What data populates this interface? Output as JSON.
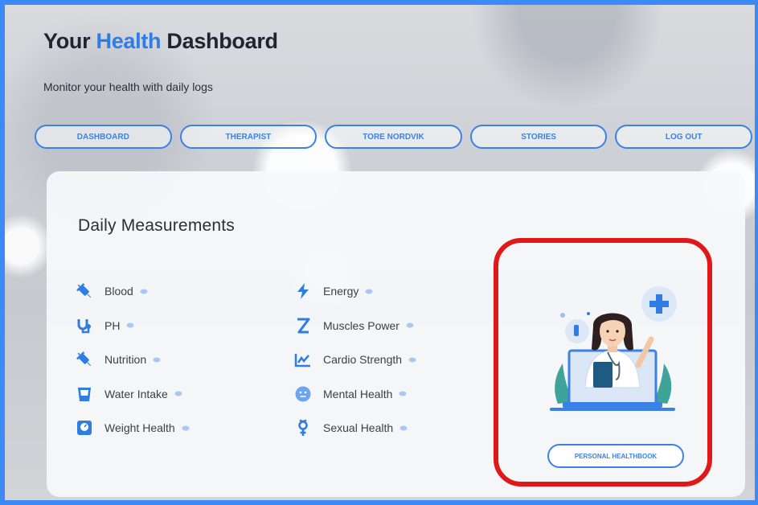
{
  "header": {
    "title_pre": "Your ",
    "title_accent": "Health",
    "title_post": " Dashboard",
    "subtitle": "Monitor your health with daily logs"
  },
  "nav": [
    {
      "label": "DASHBOARD"
    },
    {
      "label": "THERAPIST"
    },
    {
      "label": "TORE NORDVIK"
    },
    {
      "label": "STORIES"
    },
    {
      "label": "LOG OUT"
    }
  ],
  "measurements": {
    "title": "Daily Measurements",
    "left": [
      {
        "label": "Blood",
        "icon": "syringe-icon"
      },
      {
        "label": "PH",
        "icon": "stethoscope-icon"
      },
      {
        "label": "Nutrition",
        "icon": "syringe-icon"
      },
      {
        "label": "Water Intake",
        "icon": "water-glass-icon"
      },
      {
        "label": "Weight Health",
        "icon": "weight-scale-icon"
      }
    ],
    "right": [
      {
        "label": "Energy",
        "icon": "lightning-icon"
      },
      {
        "label": "Muscles Power",
        "icon": "dna-icon"
      },
      {
        "label": "Cardio Strength",
        "icon": "heart-rate-chart-icon"
      },
      {
        "label": "Mental Health",
        "icon": "face-icon"
      },
      {
        "label": "Sexual Health",
        "icon": "gender-symbol-icon"
      }
    ]
  },
  "healthbook": {
    "button_label": "PERSONAL HEALTHBOOK",
    "highlight_color": "#e01818"
  },
  "colors": {
    "accent": "#2f7de3",
    "button_outline": "#3b82e6",
    "icon": "#2f7de3",
    "frame": "#3d8af7"
  }
}
